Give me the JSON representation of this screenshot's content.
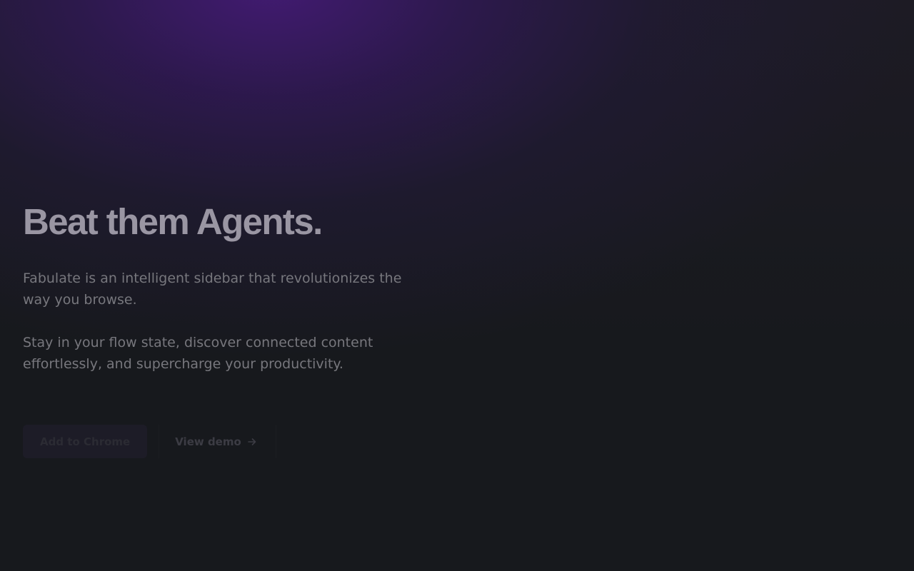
{
  "hero": {
    "title": "Beat them Agents.",
    "paragraph_1": "Fabulate is an intelligent sidebar that revolutionizes the way you browse.",
    "paragraph_2": "Stay in your flow state, discover connected content effortlessly, and supercharge your productivity."
  },
  "actions": {
    "primary_label": "Add to Chrome",
    "secondary_label": "View demo",
    "secondary_icon": "arrow-right-icon"
  },
  "colors": {
    "background": "#17191d",
    "gradient_accent": "#441b76",
    "title_text": "#9a96a3",
    "body_text": "#77777d"
  }
}
